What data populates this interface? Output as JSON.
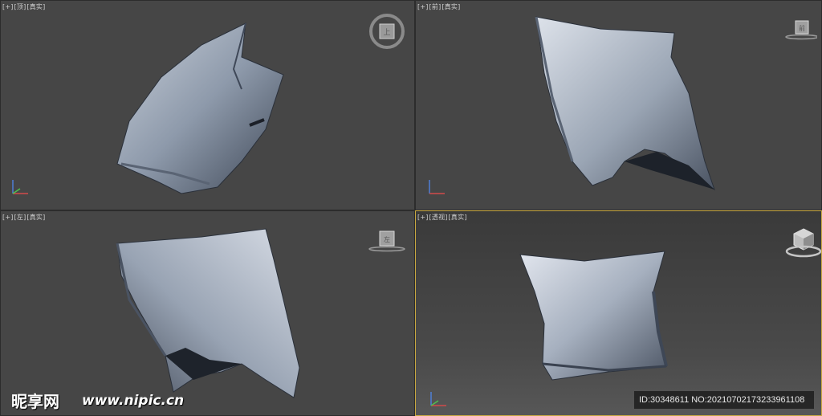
{
  "viewports": {
    "top": {
      "label": [
        "[+]",
        "[顶]",
        "[真实]"
      ],
      "cube_face": "上"
    },
    "front": {
      "label": [
        "[+]",
        "[前]",
        "[真实]"
      ],
      "cube_face": "前"
    },
    "left": {
      "label": [
        "[+]",
        "[左]",
        "[真实]"
      ],
      "cube_face": "左"
    },
    "perspective": {
      "label": [
        "[+]",
        "[透视]",
        "[真实]"
      ],
      "cube_face": ""
    }
  },
  "colors": {
    "viewport_bg": "#464646",
    "active_border": "#c9a840",
    "pillow_fabric": "#8e9aa8",
    "pillow_shadow": "#2c3440"
  },
  "watermark": {
    "logo": "昵享网",
    "url": "www.nipic.cn",
    "id_text": "ID:30348611 NO:20210702173233961108"
  },
  "icons": {
    "view_cube": "view-cube-icon",
    "axis_tripod": "axis-tripod-icon"
  }
}
